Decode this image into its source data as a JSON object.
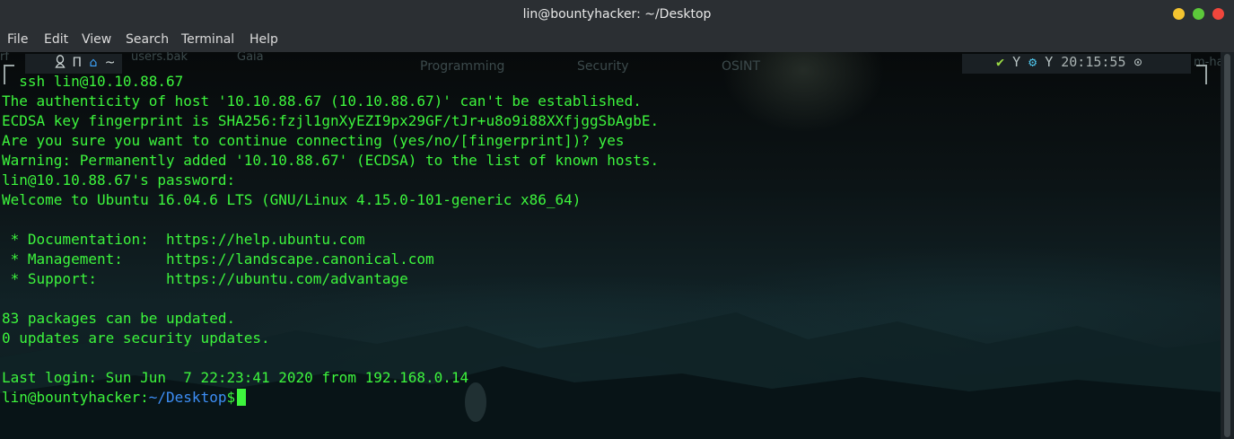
{
  "window": {
    "title": "lin@bountyhacker: ~/Desktop",
    "buttons": {
      "minimize_color": "#f4c430",
      "maximize_color": "#5cc83a",
      "close_color": "#f0463c"
    }
  },
  "menu": {
    "items": [
      "File",
      "Edit",
      "View",
      "Search",
      "Terminal",
      "Help"
    ]
  },
  "desktop_ghost_labels": {
    "left": "rf",
    "users_bak": "users.bak",
    "gaia": "Gaia",
    "programming": "Programming",
    "security": "Security",
    "osint": "OSINT",
    "right": "m-ha"
  },
  "top_panel": {
    "workspace_glyphs": "Π",
    "home_icon": "⌂",
    "tilde": "~",
    "check_glyph": "✔",
    "fork_glyph": "Y",
    "gear_glyph": "⚙",
    "fork_glyph_2": "Y",
    "time": "20:15:55",
    "clock_icon_glyph": "⊙"
  },
  "terminal": {
    "lines": [
      "  ssh lin@10.10.88.67",
      "The authenticity of host '10.10.88.67 (10.10.88.67)' can't be established.",
      "ECDSA key fingerprint is SHA256:fzjl1gnXyEZI9px29GF/tJr+u8o9i88XXfjggSbAgbE.",
      "Are you sure you want to continue connecting (yes/no/[fingerprint])? yes",
      "Warning: Permanently added '10.10.88.67' (ECDSA) to the list of known hosts.",
      "lin@10.10.88.67's password:",
      "Welcome to Ubuntu 16.04.6 LTS (GNU/Linux 4.15.0-101-generic x86_64)",
      "",
      " * Documentation:  https://help.ubuntu.com",
      " * Management:     https://landscape.canonical.com",
      " * Support:        https://ubuntu.com/advantage",
      "",
      "83 packages can be updated.",
      "0 updates are security updates.",
      "",
      "Last login: Sun Jun  7 22:23:41 2020 from 192.168.0.14"
    ],
    "prompt": {
      "user_host": "lin@bountyhacker",
      "separator": ":",
      "path": "~/Desktop",
      "symbol": "$"
    },
    "text_color": "#3df53d",
    "path_color": "#3d8ef5"
  }
}
